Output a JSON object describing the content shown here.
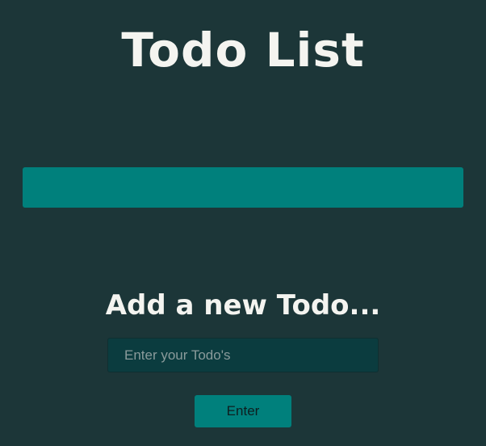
{
  "header": {
    "title": "Todo List"
  },
  "todo_list": {
    "items": []
  },
  "add_form": {
    "heading": "Add a new Todo...",
    "input_placeholder": "Enter your Todo's",
    "input_value": "",
    "button_label": "Enter"
  },
  "colors": {
    "background": "#1c3638",
    "accent": "#00807c",
    "input_background": "#0b3c3f",
    "title_text": "#f4f4f0"
  }
}
